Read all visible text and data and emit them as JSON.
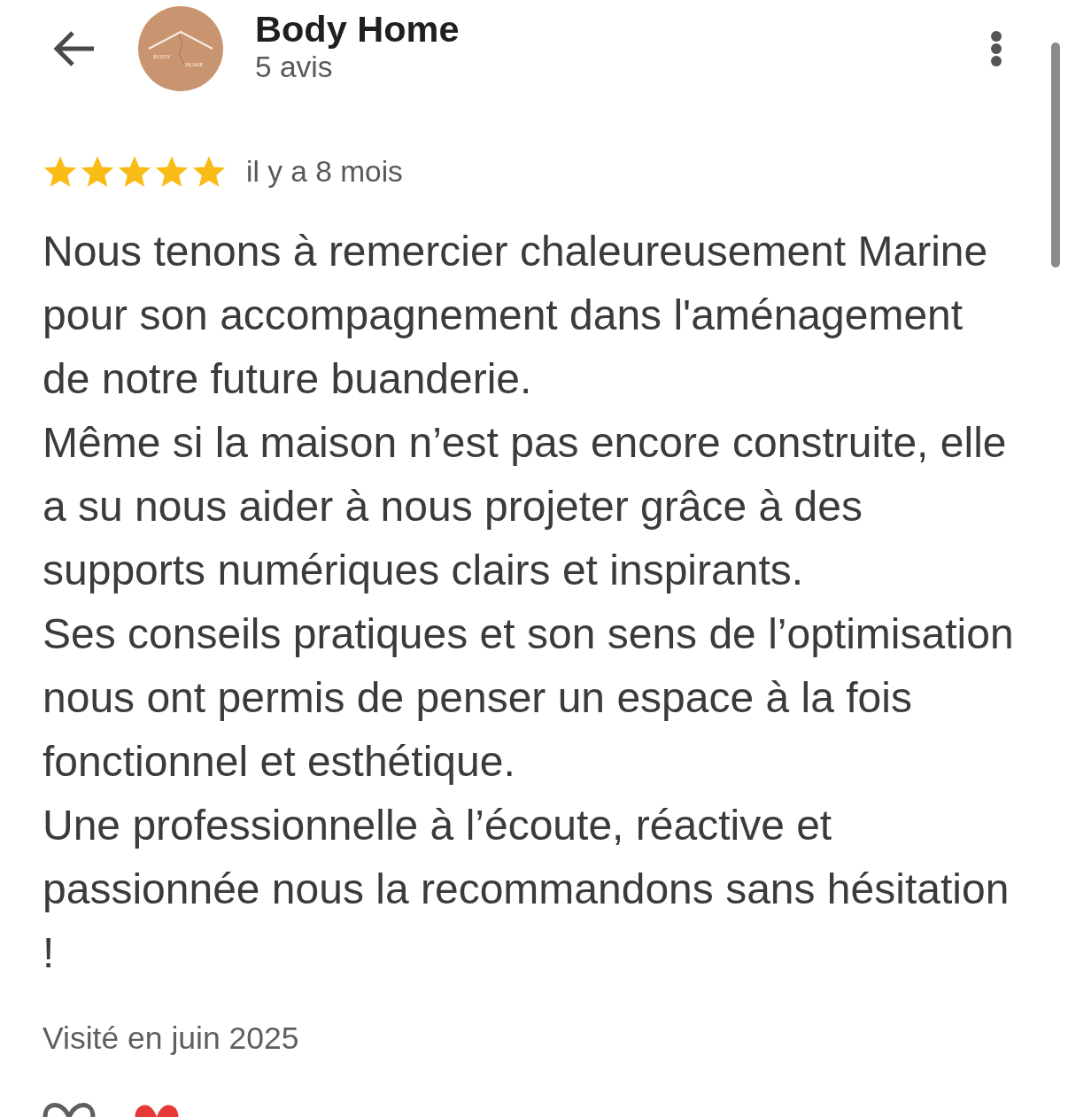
{
  "header": {
    "title": "Body Home",
    "subtitle": "5 avis",
    "logo": {
      "text_left": "BODY",
      "text_right": "HOME"
    }
  },
  "review": {
    "stars": 5,
    "time": "il y a 8 mois",
    "paragraphs": [
      "Nous tenons à remercier chaleureusement Marine pour son accompagnement dans l'aménagement de notre future buanderie.",
      "Même si la maison n’est pas encore construite, elle a su nous aider à nous projeter grâce à des supports numériques clairs et inspirants.",
      "Ses conseils pratiques et son sens de l’optimisation nous ont permis de penser un espace à la fois fonctionnel et esthétique.",
      "Une professionnelle à l’écoute, réactive et passionnée nous la recommandons sans hésitation !"
    ],
    "visited": "Visité en juin 2025"
  }
}
